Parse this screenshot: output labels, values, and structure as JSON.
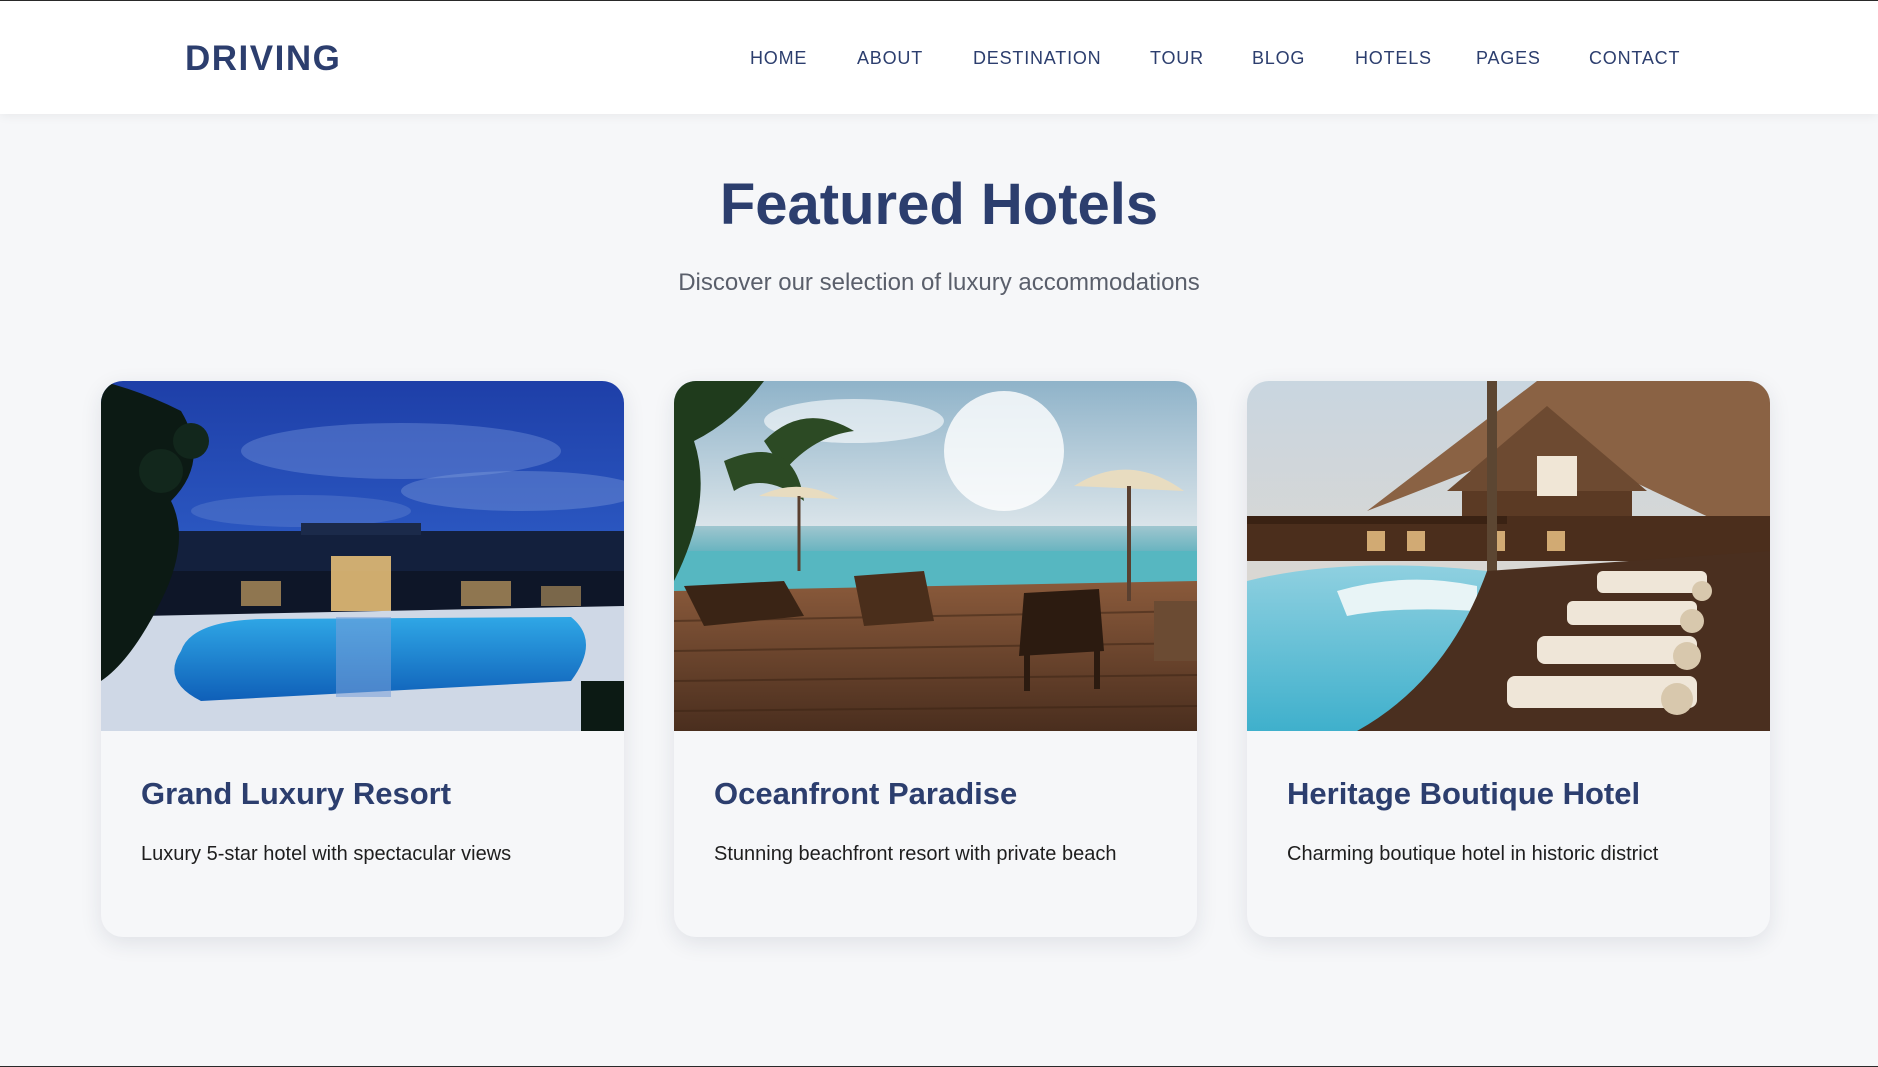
{
  "header": {
    "logo": "DRIVING",
    "nav": [
      "HOME",
      "ABOUT",
      "DESTINATION",
      "TOUR",
      "BLOG",
      "HOTELS",
      "PAGES",
      "CONTACT"
    ]
  },
  "featured": {
    "title": "Featured Hotels",
    "subtitle": "Discover our selection of luxury accommodations"
  },
  "cards": [
    {
      "title": "Grand Luxury Resort",
      "description": "Luxury 5-star hotel with spectacular views",
      "image": "night resort pool photo"
    },
    {
      "title": "Oceanfront Paradise",
      "description": "Stunning beachfront resort with private beach",
      "image": "infinity pool deck with loungers photo"
    },
    {
      "title": "Heritage Boutique Hotel",
      "description": "Charming boutique hotel in historic district",
      "image": "wooden lodge with pool photo"
    }
  ],
  "colors": {
    "brand": "#2c3e6e",
    "background": "#f6f7f9",
    "text": "#1e1e1e",
    "muted": "#5a5f6b"
  }
}
